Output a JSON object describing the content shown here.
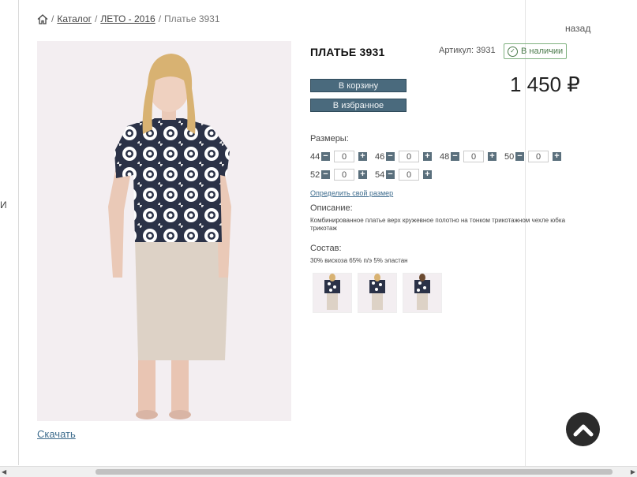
{
  "breadcrumb": {
    "catalog": "Каталог",
    "category": "ЛЕТО - 2016",
    "current": "Платье 3931",
    "separator": "/"
  },
  "back_link": "назад",
  "edge_text": "И",
  "product": {
    "title": "ПЛАТЬЕ 3931",
    "article": "Артикул: 3931",
    "stock": "В наличии",
    "price": "1 450 ₽",
    "add_to_cart": "В корзину",
    "add_to_favorites": "В избранное"
  },
  "sizes": {
    "label": "Размеры:",
    "items": [
      {
        "size": "44",
        "qty": "0"
      },
      {
        "size": "46",
        "qty": "0"
      },
      {
        "size": "48",
        "qty": "0"
      },
      {
        "size": "50",
        "qty": "0"
      },
      {
        "size": "52",
        "qty": "0"
      },
      {
        "size": "54",
        "qty": "0"
      }
    ],
    "minus": "−",
    "plus": "+",
    "size_link": "Определить свой размер"
  },
  "description": {
    "label": "Описание:",
    "text": "Комбинированное платье верх кружевное полотно на тонком  трикотажном чехле юбка трикотаж"
  },
  "composition": {
    "label": "Состав:",
    "text": "30% вискоза 65% п/э 5% эластан"
  },
  "download": "Скачать",
  "colors": {
    "button_bg": "#4a6a7d",
    "stock_green": "#7fb27f",
    "link": "#3f6d8e"
  }
}
